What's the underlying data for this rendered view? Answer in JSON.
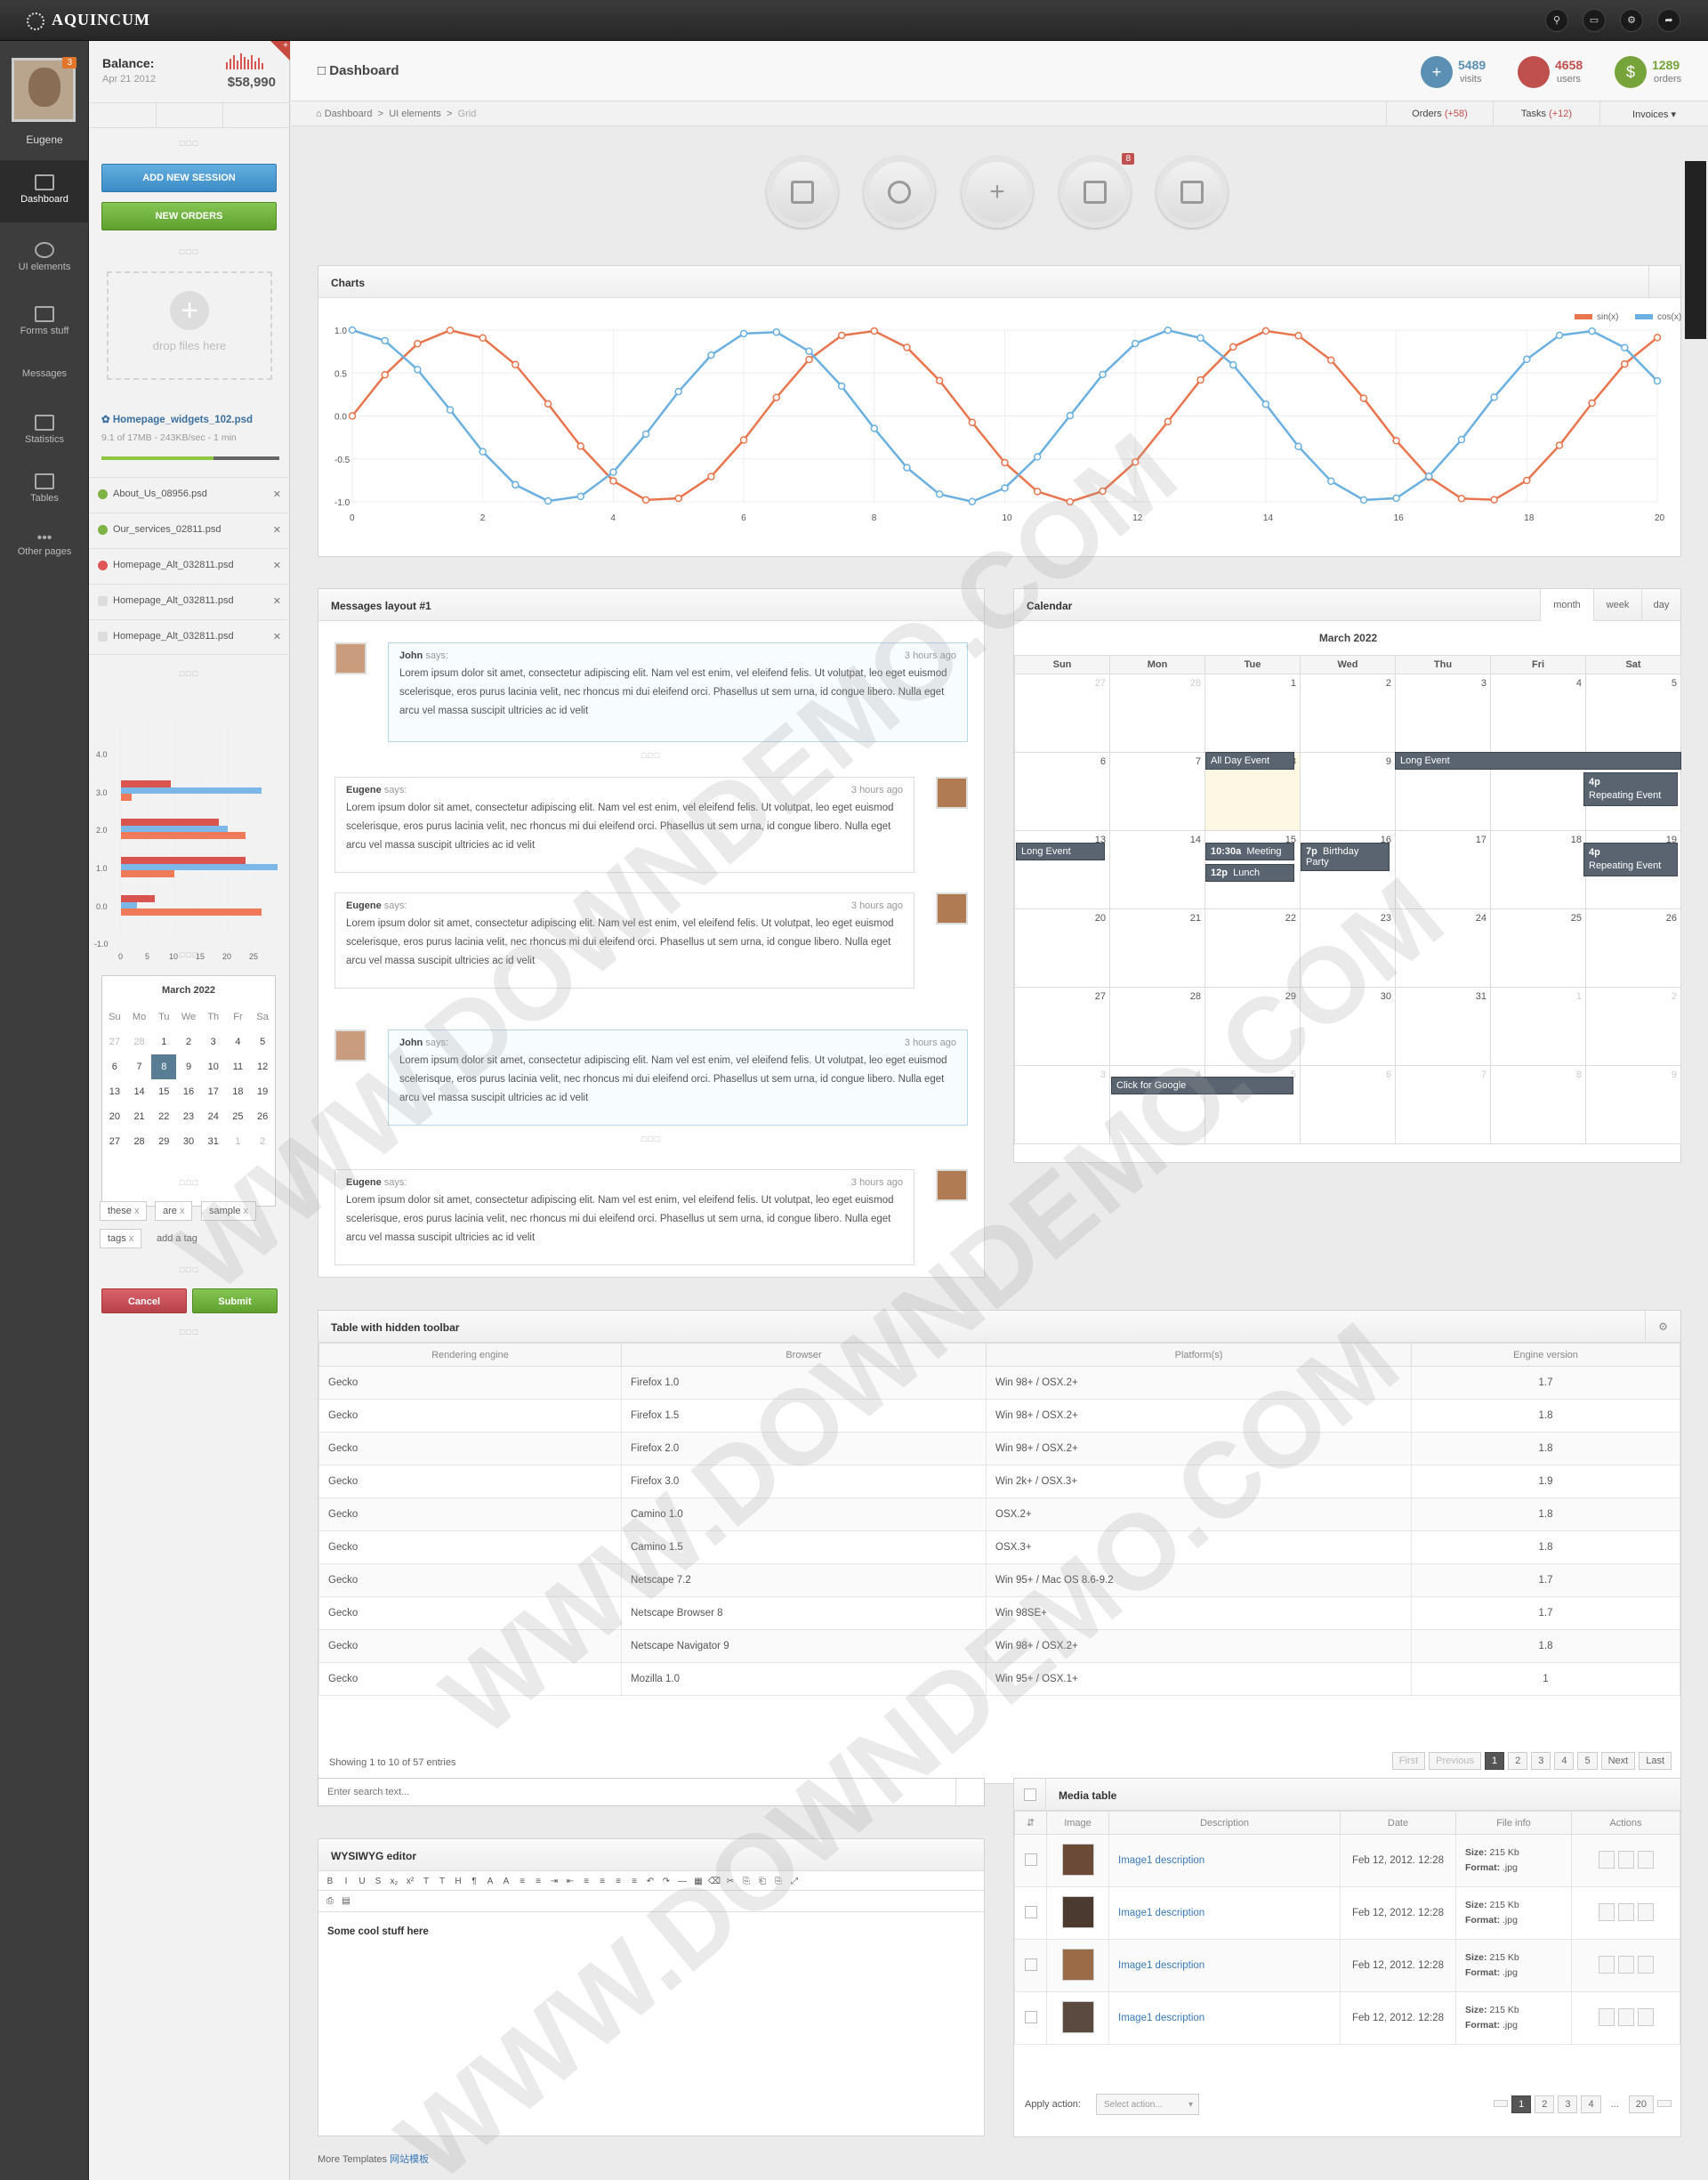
{
  "app": {
    "name": "AQUINCUM"
  },
  "user": {
    "name": "Eugene",
    "badge": "3"
  },
  "nav": [
    {
      "label": "Dashboard"
    },
    {
      "label": "UI elements"
    },
    {
      "label": "Forms stuff"
    },
    {
      "label": "Messages"
    },
    {
      "label": "Statistics"
    },
    {
      "label": "Tables"
    },
    {
      "label": "Other pages"
    }
  ],
  "balance": {
    "label": "Balance:",
    "date": "Apr 21 2012",
    "amount": "$58,990",
    "badge": "+"
  },
  "side": {
    "add_session": "ADD NEW SESSION",
    "new_orders": "NEW ORDERS",
    "drop_text": "drop files here",
    "upload_name": "Homepage_widgets_102.psd",
    "upload_info": "9.1 of 17MB - 243KB/sec - 1 min",
    "upload_progress": 0.63,
    "files": [
      {
        "name": "About_Us_08956.psd",
        "status": "done"
      },
      {
        "name": "Our_services_02811.psd",
        "status": "done"
      },
      {
        "name": "Homepage_Alt_032811.psd",
        "status": "error"
      },
      {
        "name": "Homepage_Alt_032811.psd",
        "status": "pending"
      },
      {
        "name": "Homepage_Alt_032811.psd",
        "status": "pending"
      }
    ],
    "cancel": "Cancel",
    "submit": "Submit",
    "tags": [
      "these",
      "are",
      "sample",
      "tags"
    ],
    "add_tag": "add a tag"
  },
  "mini_chart": {
    "y_ticks": [
      "4.0",
      "3.0",
      "2.0",
      "1.0",
      "0.0",
      "-1.0"
    ],
    "x_ticks": [
      "0",
      "5",
      "10",
      "15",
      "20",
      "25"
    ]
  },
  "mini_cal": {
    "title": "March 2022",
    "days": [
      "Su",
      "Mo",
      "Tu",
      "We",
      "Th",
      "Fr",
      "Sa"
    ],
    "rows": [
      [
        "27",
        "28",
        "1",
        "2",
        "3",
        "4",
        "5"
      ],
      [
        "6",
        "7",
        "8",
        "9",
        "10",
        "11",
        "12"
      ],
      [
        "13",
        "14",
        "15",
        "16",
        "17",
        "18",
        "19"
      ],
      [
        "20",
        "21",
        "22",
        "23",
        "24",
        "25",
        "26"
      ],
      [
        "27",
        "28",
        "29",
        "30",
        "31",
        "1",
        "2"
      ]
    ],
    "today": "8"
  },
  "header": {
    "title": "Dashboard",
    "stats": [
      {
        "value": "5489",
        "label": "visits",
        "color": "#5b8fb3"
      },
      {
        "value": "4658",
        "label": "users",
        "color": "#c0504d"
      },
      {
        "value": "1289",
        "label": "orders",
        "color": "#76a33a"
      }
    ]
  },
  "breadcrumb": [
    "Dashboard",
    "UI elements",
    "Grid"
  ],
  "breadright": {
    "orders": "Orders",
    "orders_count": "(+58)",
    "tasks": "Tasks",
    "tasks_count": "(+12)",
    "invoices": "Invoices"
  },
  "circle_badge": "8",
  "chart_data": {
    "type": "line",
    "title": "Charts",
    "x": [
      0,
      0.5,
      1,
      1.5,
      2,
      2.5,
      3,
      3.5,
      4,
      4.5,
      5,
      5.5,
      6,
      6.5,
      7,
      7.5,
      8,
      8.5,
      9,
      9.5,
      10,
      10.5,
      11,
      11.5,
      12,
      12.5,
      13,
      13.5,
      14,
      14.5,
      15,
      15.5,
      16,
      16.5,
      17,
      17.5,
      18,
      18.5,
      19,
      19.5,
      20
    ],
    "series": [
      {
        "name": "sin(x)",
        "color": "#e8754e"
      },
      {
        "name": "cos(x)",
        "color": "#6bb0e0"
      }
    ],
    "x_ticks": [
      "0",
      "2",
      "4",
      "6",
      "8",
      "10",
      "12",
      "14",
      "16",
      "18",
      "20"
    ],
    "y_ticks": [
      "1.0",
      "0.5",
      "0.0",
      "-0.5",
      "-1.0"
    ],
    "ylim": [
      -1,
      1
    ],
    "xlim": [
      0,
      20
    ],
    "legend": "top-right",
    "grid": true
  },
  "messages": {
    "title": "Messages layout #1",
    "items": [
      {
        "name": "John",
        "says": "says:",
        "time": "3 hours ago",
        "text": "Lorem ipsum dolor sit amet, consectetur adipiscing elit. Nam vel est enim, vel eleifend felis. Ut volutpat, leo eget euismod scelerisque, eros purus lacinia velit, nec rhoncus mi dui eleifend orci. Phasellus ut sem urna, id congue libero. Nulla eget arcu vel massa suscipit ultricies ac id velit"
      },
      {
        "name": "Eugene",
        "says": "says:",
        "time": "3 hours ago",
        "text": "Lorem ipsum dolor sit amet, consectetur adipiscing elit. Nam vel est enim, vel eleifend felis. Ut volutpat, leo eget euismod scelerisque, eros purus lacinia velit, nec rhoncus mi dui eleifend orci. Phasellus ut sem urna, id congue libero. Nulla eget arcu vel massa suscipit ultricies ac id velit"
      },
      {
        "name": "Eugene",
        "says": "says:",
        "time": "3 hours ago",
        "text": "Lorem ipsum dolor sit amet, consectetur adipiscing elit. Nam vel est enim, vel eleifend felis. Ut volutpat, leo eget euismod scelerisque, eros purus lacinia velit, nec rhoncus mi dui eleifend orci. Phasellus ut sem urna, id congue libero. Nulla eget arcu vel massa suscipit ultricies ac id velit"
      },
      {
        "name": "John",
        "says": "says:",
        "time": "3 hours ago",
        "text": "Lorem ipsum dolor sit amet, consectetur adipiscing elit. Nam vel est enim, vel eleifend felis. Ut volutpat, leo eget euismod scelerisque, eros purus lacinia velit, nec rhoncus mi dui eleifend orci. Phasellus ut sem urna, id congue libero. Nulla eget arcu vel massa suscipit ultricies ac id velit"
      },
      {
        "name": "Eugene",
        "says": "says:",
        "time": "3 hours ago",
        "text": "Lorem ipsum dolor sit amet, consectetur adipiscing elit. Nam vel est enim, vel eleifend felis. Ut volutpat, leo eget euismod scelerisque, eros purus lacinia velit, nec rhoncus mi dui eleifend orci. Phasellus ut sem urna, id congue libero. Nulla eget arcu vel massa suscipit ultricies ac id velit"
      }
    ]
  },
  "calendar": {
    "title": "Calendar",
    "views": [
      "month",
      "week",
      "day"
    ],
    "month": "March 2022",
    "days": [
      "Sun",
      "Mon",
      "Tue",
      "Wed",
      "Thu",
      "Fri",
      "Sat"
    ],
    "rows": [
      [
        "27",
        "28",
        "1",
        "2",
        "3",
        "4",
        "5"
      ],
      [
        "6",
        "7",
        "8",
        "9",
        "10",
        "11",
        "12"
      ],
      [
        "13",
        "14",
        "15",
        "16",
        "17",
        "18",
        "19"
      ],
      [
        "20",
        "21",
        "22",
        "23",
        "24",
        "25",
        "26"
      ],
      [
        "27",
        "28",
        "29",
        "30",
        "31",
        "1",
        "2"
      ],
      [
        "3",
        "4",
        "5",
        "6",
        "7",
        "8",
        "9"
      ]
    ],
    "events": {
      "all_day": "All Day Event",
      "long1": "Long Event",
      "rep1_t": "4p",
      "rep1": "Repeating Event",
      "long2": "Long Event",
      "meet_t": "10:30a",
      "meet": "Meeting",
      "lunch_t": "12p",
      "lunch": "Lunch",
      "bday_t": "7p",
      "bday": "Birthday Party",
      "rep2_t": "4p",
      "rep2": "Repeating Event",
      "google": "Click for Google"
    }
  },
  "table": {
    "title": "Table with hidden toolbar",
    "headers": [
      "Rendering engine",
      "Browser",
      "Platform(s)",
      "Engine version"
    ],
    "rows": [
      [
        "Gecko",
        "Firefox 1.0",
        "Win 98+ / OSX.2+",
        "1.7"
      ],
      [
        "Gecko",
        "Firefox 1.5",
        "Win 98+ / OSX.2+",
        "1.8"
      ],
      [
        "Gecko",
        "Firefox 2.0",
        "Win 98+ / OSX.2+",
        "1.8"
      ],
      [
        "Gecko",
        "Firefox 3.0",
        "Win 2k+ / OSX.3+",
        "1.9"
      ],
      [
        "Gecko",
        "Camino 1.0",
        "OSX.2+",
        "1.8"
      ],
      [
        "Gecko",
        "Camino 1.5",
        "OSX.3+",
        "1.8"
      ],
      [
        "Gecko",
        "Netscape 7.2",
        "Win 95+ / Mac OS 8.6-9.2",
        "1.7"
      ],
      [
        "Gecko",
        "Netscape Browser 8",
        "Win 98SE+",
        "1.7"
      ],
      [
        "Gecko",
        "Netscape Navigator 9",
        "Win 98+ / OSX.2+",
        "1.8"
      ],
      [
        "Gecko",
        "Mozilla 1.0",
        "Win 95+ / OSX.1+",
        "1"
      ]
    ],
    "info": "Showing 1 to 10 of 57 entries",
    "pages": [
      "First",
      "Previous",
      "1",
      "2",
      "3",
      "4",
      "5",
      "Next",
      "Last"
    ]
  },
  "search": {
    "placeholder": "Enter search text..."
  },
  "editor": {
    "title": "WYSIWYG editor",
    "content": "Some cool stuff here"
  },
  "media": {
    "title": "Media table",
    "headers": [
      "Image",
      "Description",
      "Date",
      "File info",
      "Actions"
    ],
    "rows": [
      {
        "desc": "Image1 description",
        "date": "Feb 12, 2012. 12:28",
        "size_l": "Size:",
        "size": "215 Kb",
        "format_l": "Format:",
        "format": ".jpg"
      },
      {
        "desc": "Image1 description",
        "date": "Feb 12, 2012. 12:28",
        "size_l": "Size:",
        "size": "215 Kb",
        "format_l": "Format:",
        "format": ".jpg"
      },
      {
        "desc": "Image1 description",
        "date": "Feb 12, 2012. 12:28",
        "size_l": "Size:",
        "size": "215 Kb",
        "format_l": "Format:",
        "format": ".jpg"
      },
      {
        "desc": "Image1 description",
        "date": "Feb 12, 2012. 12:28",
        "size_l": "Size:",
        "size": "215 Kb",
        "format_l": "Format:",
        "format": ".jpg"
      }
    ],
    "apply_label": "Apply action:",
    "select_placeholder": "Select action...",
    "pages": [
      "1",
      "2",
      "3",
      "4",
      "...",
      "20"
    ]
  },
  "footer": {
    "text": "More Templates",
    "link": "网站模板"
  },
  "watermark": "WWW.DOWNDEMO.COM"
}
